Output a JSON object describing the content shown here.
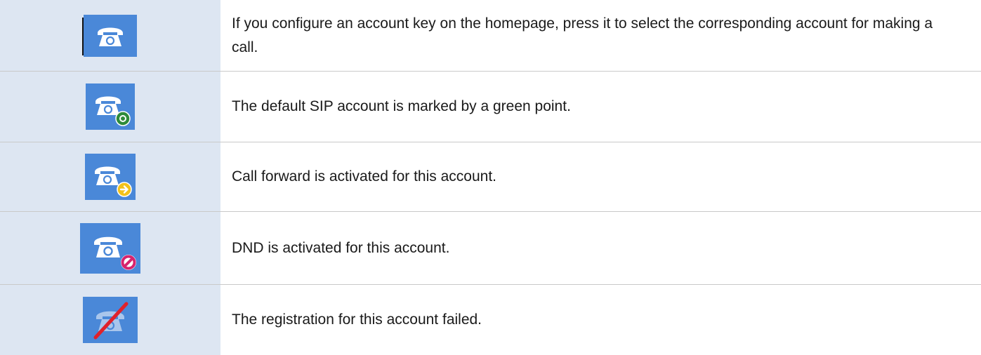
{
  "rows": [
    {
      "icon": "phone-icon",
      "text": "If you configure an account key on the homepage, press it to select the corresponding account for making a call."
    },
    {
      "icon": "phone-default-account-icon",
      "badge_color": "#2e8b3a",
      "text": "The default SIP account is marked by a green point."
    },
    {
      "icon": "phone-call-forward-icon",
      "badge_color": "#f2c21b",
      "text": "Call forward is activated for this account."
    },
    {
      "icon": "phone-dnd-icon",
      "badge_color": "#d6246e",
      "text": "DND is activated for this account."
    },
    {
      "icon": "phone-registration-failed-icon",
      "slash_color": "#e0212b",
      "text": "The registration for this account failed."
    }
  ],
  "colors": {
    "icon_cell_bg": "#dde6f2",
    "icon_bg": "#4a88d8",
    "divider": "#c9c9c9"
  }
}
